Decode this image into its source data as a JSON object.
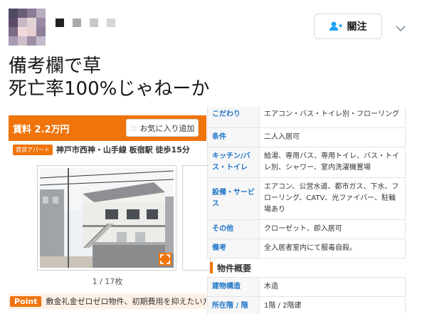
{
  "tweet": {
    "follow_label": "關注",
    "text_lines": [
      "備考欄で草",
      "死亡率100%じゃねーか"
    ]
  },
  "listing": {
    "price": "賃料 2.2万円",
    "favorite_label": "お気に入り追加",
    "type_badge": "賃貸アパート",
    "location": "神戸市西神・山手線 板宿駅 徒歩15分",
    "photo_counter": "1 / 17枚",
    "point_badge": "Point",
    "point_text": "敷金礼金ゼロゼロ物件、初期費用を抑えたい方",
    "specs": [
      {
        "key": "こだわり",
        "value": "エアコン・バス・トイレ別・フローリング"
      },
      {
        "key": "条件",
        "value": "二人入居可"
      },
      {
        "key": "キッチン/バス・トイレ",
        "value": "給湯、専用バス、専用トイレ、バス・トイレ別、シャワー、室内洗濯機置場"
      },
      {
        "key": "設備・サービス",
        "value": "エアコン、公営水道、都市ガス、下水、フローリング、CATV、光ファイバー、駐輪場あり"
      },
      {
        "key": "その他",
        "value": "クローゼット、即入居可"
      },
      {
        "key": "備考",
        "value": "全入居者室内にて服毒自殺。"
      }
    ],
    "section_title": "物件概要",
    "overview": [
      {
        "key": "建物構造",
        "value": "木造"
      },
      {
        "key": "所在階 / 階",
        "value": "1階 / 2階建"
      }
    ]
  },
  "colors": {
    "accent_orange": "#f0740c",
    "spec_key_blue": "#1f75c7",
    "follow_icon_blue": "#1da1f2"
  }
}
